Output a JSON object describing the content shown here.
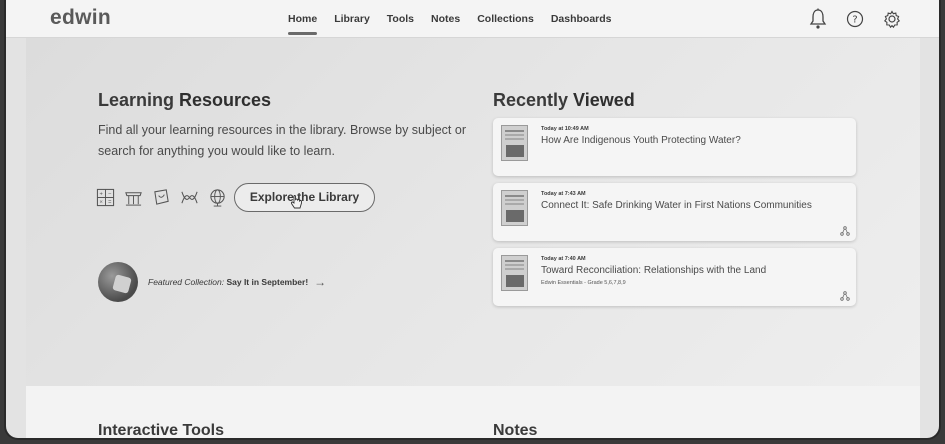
{
  "app": {
    "logo": "edwin"
  },
  "nav": {
    "items": [
      "Home",
      "Library",
      "Tools",
      "Notes",
      "Collections",
      "Dashboards"
    ],
    "active": "Home"
  },
  "top_icons": [
    "bell-icon",
    "help-icon",
    "settings-gear-icon"
  ],
  "learning_resources": {
    "title_prefix": "Learning ",
    "title_bold": "Resources",
    "description": "Find all your learning resources in the library. Browse by subject or search for anything you would like to learn.",
    "subject_icons": [
      "math-icon",
      "social-studies-icon",
      "language-arts-icon",
      "science-dna-icon",
      "globe-icon"
    ],
    "explore_button": "Explore the Library"
  },
  "featured": {
    "label": "Featured Collection:",
    "name": "Say It in September!",
    "arrow": "→"
  },
  "recently_viewed": {
    "title_prefix": "Recently ",
    "title_bold": "Viewed",
    "items": [
      {
        "time": "Today at 10:49 AM",
        "title": "How Are Indigenous Youth Protecting Water?",
        "subtitle": "",
        "shared": false
      },
      {
        "time": "Today at 7:43 AM",
        "title": "Connect It: Safe Drinking Water in First Nations Communities",
        "subtitle": "",
        "shared": true
      },
      {
        "time": "Today at 7:40 AM",
        "title": "Toward Reconciliation: Relationships with the Land",
        "subtitle": "Edwin Essentials - Grade 5,6,7,8,9",
        "shared": true
      }
    ]
  },
  "lower": {
    "tools_prefix": "Interactive ",
    "tools_bold": "Tools",
    "notes": "Notes"
  }
}
